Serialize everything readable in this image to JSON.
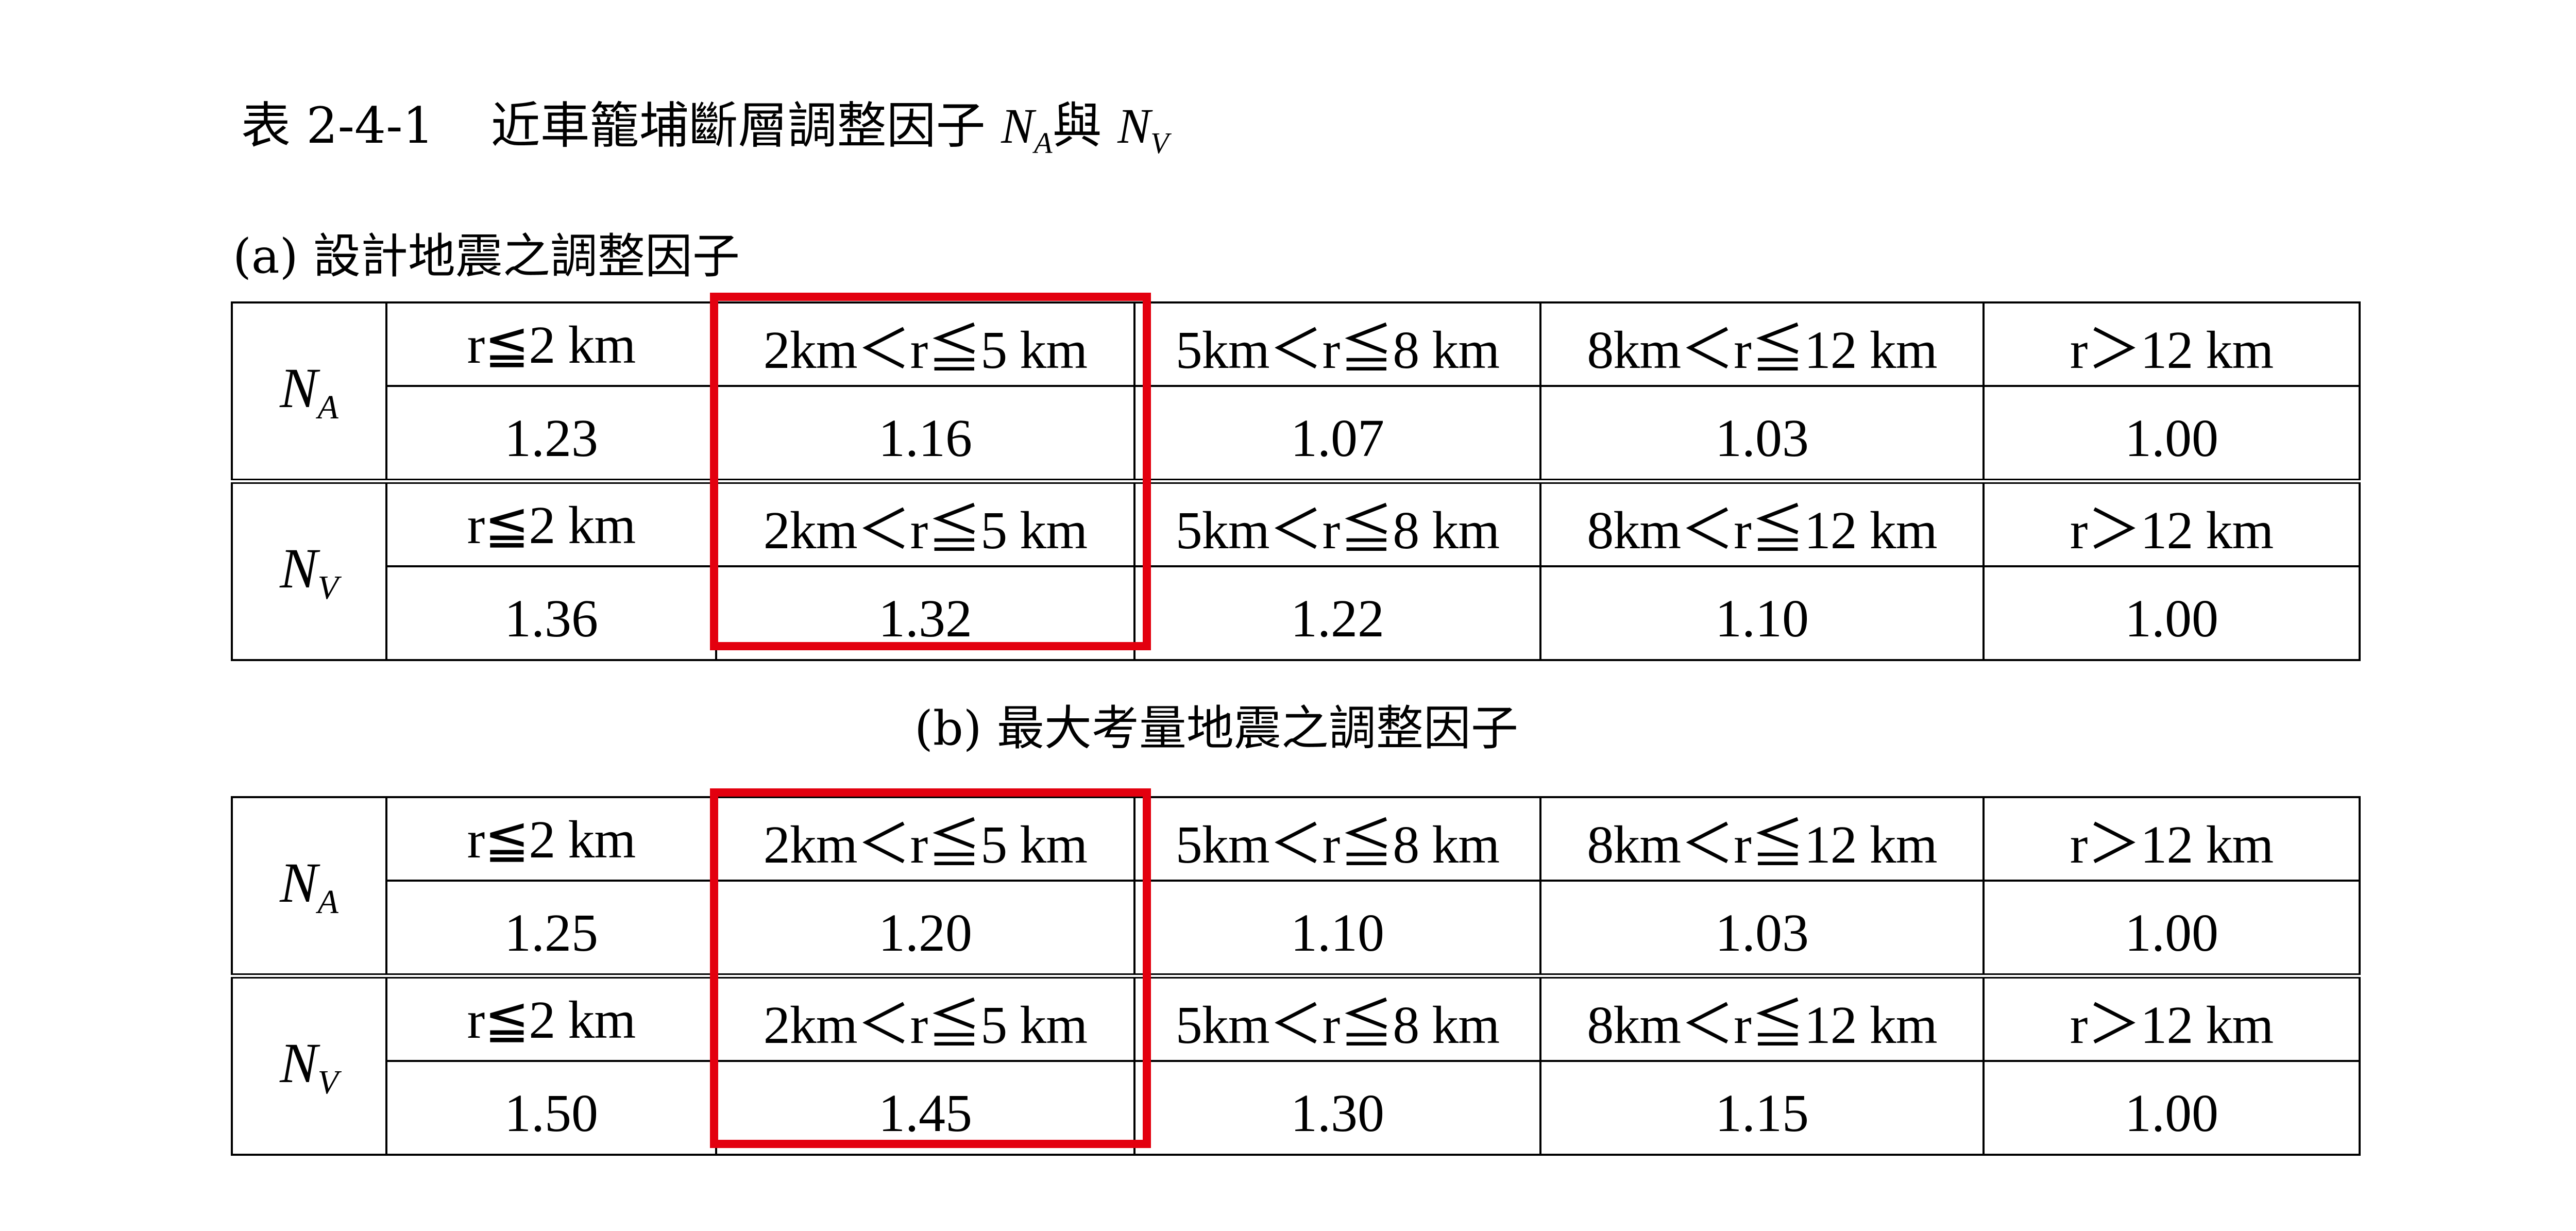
{
  "title": {
    "prefix": "表 2-4-1",
    "text": "近車籠埔斷層調整因子",
    "na_base": "N",
    "na_sub": "A",
    "connector": "與",
    "nv_base": "N",
    "nv_sub": "V"
  },
  "ranges": [
    "r≦2 km",
    "2km＜r≦5 km",
    "5km＜r≦8 km",
    "8km＜r≦12 km",
    "r＞12 km"
  ],
  "labels": {
    "na_base": "N",
    "na_sub": "A",
    "nv_base": "N",
    "nv_sub": "V"
  },
  "tables": [
    {
      "caption": "(a) 設計地震之調整因子",
      "na_values": [
        "1.23",
        "1.16",
        "1.07",
        "1.03",
        "1.00"
      ],
      "nv_values": [
        "1.36",
        "1.32",
        "1.22",
        "1.10",
        "1.00"
      ]
    },
    {
      "caption": "(b) 最大考量地震之調整因子",
      "na_values": [
        "1.25",
        "1.20",
        "1.10",
        "1.03",
        "1.00"
      ],
      "nv_values": [
        "1.50",
        "1.45",
        "1.30",
        "1.15",
        "1.00"
      ]
    }
  ],
  "highlight": {
    "color": "#e3000f",
    "column": "2km＜r≦5 km"
  }
}
